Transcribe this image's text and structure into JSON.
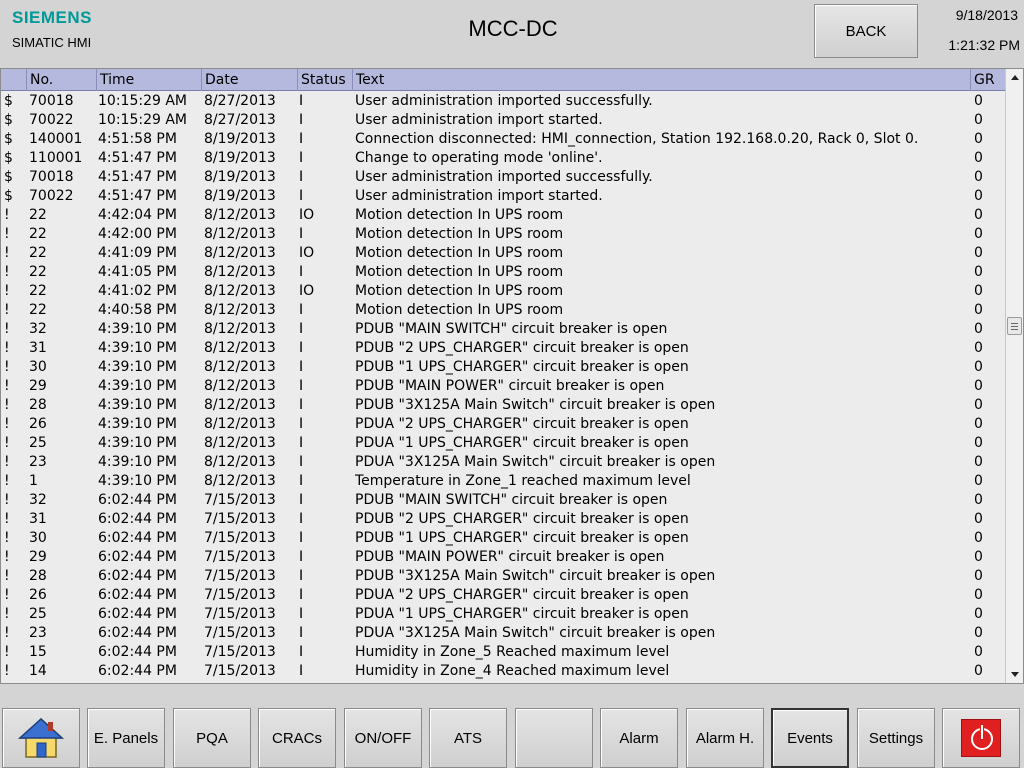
{
  "header": {
    "brand": "SIEMENS",
    "product": "SIMATIC HMI",
    "screen_title": "MCC-DC",
    "back_label": "BACK",
    "date": "9/18/2013",
    "time": "1:21:32 PM"
  },
  "alarm_view": {
    "columns": [
      "",
      "No.",
      "Time",
      "Date",
      "Status",
      "Text",
      "GR"
    ],
    "rows": [
      [
        "$",
        "70018",
        "10:15:29 AM",
        "8/27/2013",
        "I",
        "User administration imported successfully.",
        "0"
      ],
      [
        "$",
        "70022",
        "10:15:29 AM",
        "8/27/2013",
        "I",
        "User administration import started.",
        "0"
      ],
      [
        "$",
        "140001",
        "4:51:58 PM",
        "8/19/2013",
        "I",
        "Connection disconnected: HMI_connection, Station 192.168.0.20, Rack 0, Slot 0.",
        "0"
      ],
      [
        "$",
        "110001",
        "4:51:47 PM",
        "8/19/2013",
        "I",
        "Change to operating mode 'online'.",
        "0"
      ],
      [
        "$",
        "70018",
        "4:51:47 PM",
        "8/19/2013",
        "I",
        "User administration imported successfully.",
        "0"
      ],
      [
        "$",
        "70022",
        "4:51:47 PM",
        "8/19/2013",
        "I",
        "User administration import started.",
        "0"
      ],
      [
        "!",
        "22",
        "4:42:04 PM",
        "8/12/2013",
        "IO",
        "Motion detection In UPS room",
        "0"
      ],
      [
        "!",
        "22",
        "4:42:00 PM",
        "8/12/2013",
        "I",
        "Motion detection In UPS room",
        "0"
      ],
      [
        "!",
        "22",
        "4:41:09 PM",
        "8/12/2013",
        "IO",
        "Motion detection In UPS room",
        "0"
      ],
      [
        "!",
        "22",
        "4:41:05 PM",
        "8/12/2013",
        "I",
        "Motion detection In UPS room",
        "0"
      ],
      [
        "!",
        "22",
        "4:41:02 PM",
        "8/12/2013",
        "IO",
        "Motion detection In UPS room",
        "0"
      ],
      [
        "!",
        "22",
        "4:40:58 PM",
        "8/12/2013",
        "I",
        "Motion detection In UPS room",
        "0"
      ],
      [
        "!",
        "32",
        "4:39:10 PM",
        "8/12/2013",
        "I",
        "PDUB \"MAIN SWITCH\" circuit breaker is open",
        "0"
      ],
      [
        "!",
        "31",
        "4:39:10 PM",
        "8/12/2013",
        "I",
        "PDUB \"2 UPS_CHARGER\" circuit breaker is open",
        "0"
      ],
      [
        "!",
        "30",
        "4:39:10 PM",
        "8/12/2013",
        "I",
        "PDUB \"1 UPS_CHARGER\" circuit breaker is open",
        "0"
      ],
      [
        "!",
        "29",
        "4:39:10 PM",
        "8/12/2013",
        "I",
        "PDUB \"MAIN POWER\" circuit breaker is open",
        "0"
      ],
      [
        "!",
        "28",
        "4:39:10 PM",
        "8/12/2013",
        "I",
        "PDUB \"3X125A Main Switch\" circuit breaker is open",
        "0"
      ],
      [
        "!",
        "26",
        "4:39:10 PM",
        "8/12/2013",
        "I",
        "PDUA \"2 UPS_CHARGER\" circuit breaker is open",
        "0"
      ],
      [
        "!",
        "25",
        "4:39:10 PM",
        "8/12/2013",
        "I",
        "PDUA \"1 UPS_CHARGER\" circuit breaker is open",
        "0"
      ],
      [
        "!",
        "23",
        "4:39:10 PM",
        "8/12/2013",
        "I",
        "PDUA \"3X125A Main Switch\" circuit breaker is open",
        "0"
      ],
      [
        "!",
        "1",
        "4:39:10 PM",
        "8/12/2013",
        "I",
        "Temperature in Zone_1 reached maximum level",
        "0"
      ],
      [
        "!",
        "32",
        "6:02:44 PM",
        "7/15/2013",
        "I",
        "PDUB \"MAIN SWITCH\" circuit breaker is open",
        "0"
      ],
      [
        "!",
        "31",
        "6:02:44 PM",
        "7/15/2013",
        "I",
        "PDUB \"2 UPS_CHARGER\" circuit breaker is open",
        "0"
      ],
      [
        "!",
        "30",
        "6:02:44 PM",
        "7/15/2013",
        "I",
        "PDUB \"1 UPS_CHARGER\" circuit breaker is open",
        "0"
      ],
      [
        "!",
        "29",
        "6:02:44 PM",
        "7/15/2013",
        "I",
        "PDUB \"MAIN POWER\" circuit breaker is open",
        "0"
      ],
      [
        "!",
        "28",
        "6:02:44 PM",
        "7/15/2013",
        "I",
        "PDUB \"3X125A Main Switch\" circuit breaker is open",
        "0"
      ],
      [
        "!",
        "26",
        "6:02:44 PM",
        "7/15/2013",
        "I",
        "PDUA \"2 UPS_CHARGER\" circuit breaker is open",
        "0"
      ],
      [
        "!",
        "25",
        "6:02:44 PM",
        "7/15/2013",
        "I",
        "PDUA \"1 UPS_CHARGER\" circuit breaker is open",
        "0"
      ],
      [
        "!",
        "23",
        "6:02:44 PM",
        "7/15/2013",
        "I",
        "PDUA \"3X125A Main Switch\" circuit breaker is open",
        "0"
      ],
      [
        "!",
        "15",
        "6:02:44 PM",
        "7/15/2013",
        "I",
        "Humidity in Zone_5 Reached maximum level",
        "0"
      ],
      [
        "!",
        "14",
        "6:02:44 PM",
        "7/15/2013",
        "I",
        "Humidity in Zone_4 Reached maximum level",
        "0"
      ]
    ]
  },
  "footer": {
    "buttons": [
      {
        "label": "",
        "icon": "home-icon"
      },
      {
        "label": "E. Panels"
      },
      {
        "label": "PQA"
      },
      {
        "label": "CRACs"
      },
      {
        "label": "ON/OFF"
      },
      {
        "label": "ATS"
      },
      {
        "label": ""
      },
      {
        "label": "Alarm"
      },
      {
        "label": "Alarm H."
      },
      {
        "label": "Events",
        "active": true
      },
      {
        "label": "Settings"
      },
      {
        "label": "",
        "icon": "power-icon"
      }
    ]
  },
  "colors": {
    "brand": "#009999",
    "header_row": "#b5b9de",
    "background": "#d4d4d4",
    "power": "#e02020"
  }
}
